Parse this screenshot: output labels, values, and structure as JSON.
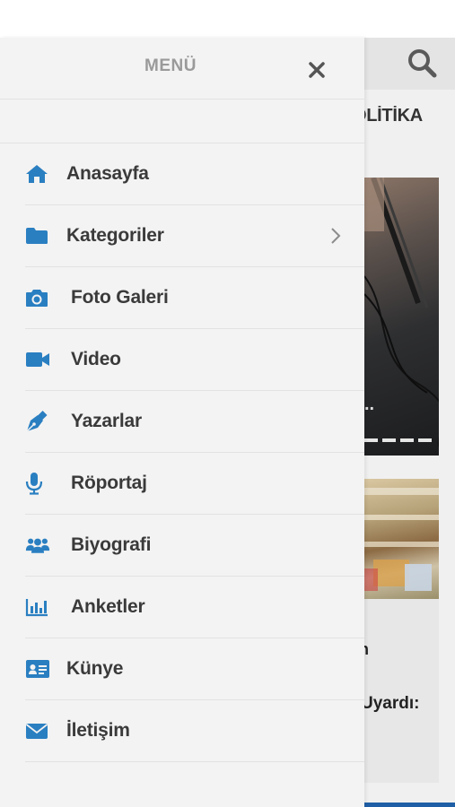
{
  "drawer": {
    "title": "MENÜ",
    "items": [
      {
        "label": "Anasayfa",
        "icon": "home-icon"
      },
      {
        "label": "Kategoriler",
        "icon": "folder-icon",
        "has_submenu": true
      },
      {
        "label": "Foto Galeri",
        "icon": "camera-icon"
      },
      {
        "label": "Video",
        "icon": "video-camera-icon"
      },
      {
        "label": "Yazarlar",
        "icon": "pen-icon"
      },
      {
        "label": "Röportaj",
        "icon": "microphone-icon"
      },
      {
        "label": "Biyografi",
        "icon": "users-icon"
      },
      {
        "label": "Anketler",
        "icon": "bar-chart-icon"
      },
      {
        "label": "Künye",
        "icon": "id-card-icon"
      },
      {
        "label": "İletişim",
        "icon": "envelope-icon"
      }
    ]
  },
  "background": {
    "category_text": "OLİTİKA",
    "headline_partial": "Uyardı:",
    "partial_letter": "n",
    "image_dots": ".."
  },
  "colors": {
    "accent": "#2a7fc1",
    "drawer_bg": "#f3f3f3",
    "title_gray": "#9a9a9a",
    "label_dark": "#3a3a3a"
  }
}
